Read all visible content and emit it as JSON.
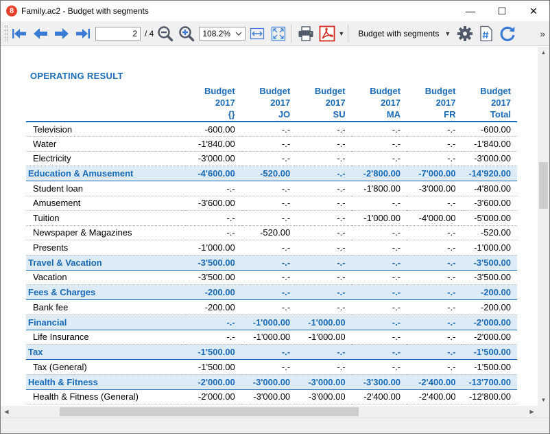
{
  "window": {
    "title": "Family.ac2 - Budget with segments",
    "app_icon": "8",
    "minimize": "—",
    "maximize": "☐",
    "close": "✕"
  },
  "toolbar": {
    "page_current": "2",
    "page_total": "/ 4",
    "zoom": "108.2%",
    "layout": "Budget with segments",
    "more": "»"
  },
  "report": {
    "section_title": "OPERATING RESULT",
    "columns": [
      {
        "l1": "",
        "l2": "",
        "l3": ""
      },
      {
        "l1": "Budget",
        "l2": "2017",
        "l3": "{}"
      },
      {
        "l1": "Budget",
        "l2": "2017",
        "l3": "JO"
      },
      {
        "l1": "Budget",
        "l2": "2017",
        "l3": "SU"
      },
      {
        "l1": "Budget",
        "l2": "2017",
        "l3": "MA"
      },
      {
        "l1": "Budget",
        "l2": "2017",
        "l3": "FR"
      },
      {
        "l1": "Budget",
        "l2": "2017",
        "l3": "Total"
      }
    ],
    "rows": [
      {
        "type": "item",
        "cells": [
          "Television",
          "-600.00",
          "-.-",
          "-.-",
          "-.-",
          "-.-",
          "-600.00"
        ]
      },
      {
        "type": "item",
        "cells": [
          "Water",
          "-1'840.00",
          "-.-",
          "-.-",
          "-.-",
          "-.-",
          "-1'840.00"
        ]
      },
      {
        "type": "item",
        "cells": [
          "Electricity",
          "-3'000.00",
          "-.-",
          "-.-",
          "-.-",
          "-.-",
          "-3'000.00"
        ]
      },
      {
        "type": "group",
        "cells": [
          "Education & Amusement",
          "-4'600.00",
          "-520.00",
          "-.-",
          "-2'800.00",
          "-7'000.00",
          "-14'920.00"
        ]
      },
      {
        "type": "item",
        "cells": [
          "Student loan",
          "-.-",
          "-.-",
          "-.-",
          "-1'800.00",
          "-3'000.00",
          "-4'800.00"
        ]
      },
      {
        "type": "item",
        "cells": [
          "Amusement",
          "-3'600.00",
          "-.-",
          "-.-",
          "-.-",
          "-.-",
          "-3'600.00"
        ]
      },
      {
        "type": "item",
        "cells": [
          "Tuition",
          "-.-",
          "-.-",
          "-.-",
          "-1'000.00",
          "-4'000.00",
          "-5'000.00"
        ]
      },
      {
        "type": "item",
        "cells": [
          "Newspaper & Magazines",
          "-.-",
          "-520.00",
          "-.-",
          "-.-",
          "-.-",
          "-520.00"
        ]
      },
      {
        "type": "item",
        "cells": [
          "Presents",
          "-1'000.00",
          "-.-",
          "-.-",
          "-.-",
          "-.-",
          "-1'000.00"
        ]
      },
      {
        "type": "group",
        "cells": [
          "Travel & Vacation",
          "-3'500.00",
          "-.-",
          "-.-",
          "-.-",
          "-.-",
          "-3'500.00"
        ]
      },
      {
        "type": "item",
        "cells": [
          "Vacation",
          "-3'500.00",
          "-.-",
          "-.-",
          "-.-",
          "-.-",
          "-3'500.00"
        ]
      },
      {
        "type": "group",
        "cells": [
          "Fees & Charges",
          "-200.00",
          "-.-",
          "-.-",
          "-.-",
          "-.-",
          "-200.00"
        ]
      },
      {
        "type": "item",
        "cells": [
          "Bank fee",
          "-200.00",
          "-.-",
          "-.-",
          "-.-",
          "-.-",
          "-200.00"
        ]
      },
      {
        "type": "group",
        "cells": [
          "Financial",
          "-.-",
          "-1'000.00",
          "-1'000.00",
          "-.-",
          "-.-",
          "-2'000.00"
        ]
      },
      {
        "type": "item",
        "cells": [
          "Life Insurance",
          "-.-",
          "-1'000.00",
          "-1'000.00",
          "-.-",
          "-.-",
          "-2'000.00"
        ]
      },
      {
        "type": "group",
        "cells": [
          "Tax",
          "-1'500.00",
          "-.-",
          "-.-",
          "-.-",
          "-.-",
          "-1'500.00"
        ]
      },
      {
        "type": "item",
        "cells": [
          "Tax (General)",
          "-1'500.00",
          "-.-",
          "-.-",
          "-.-",
          "-.-",
          "-1'500.00"
        ]
      },
      {
        "type": "group",
        "cells": [
          "Health & Fitness",
          "-2'000.00",
          "-3'000.00",
          "-3'000.00",
          "-3'300.00",
          "-2'400.00",
          "-13'700.00"
        ]
      },
      {
        "type": "item",
        "cells": [
          "Health & Fitness (General)",
          "-2'000.00",
          "-3'000.00",
          "-3'000.00",
          "-2'400.00",
          "-2'400.00",
          "-12'800.00"
        ]
      }
    ]
  },
  "colors": {
    "accent": "#1a6ab5",
    "group_background": "#dcebf5",
    "pdf_red": "#d3291e"
  },
  "icons": {
    "first_page": "arrow-first-icon",
    "prev_page": "arrow-left-icon",
    "next_page": "arrow-right-icon",
    "last_page": "arrow-last-icon",
    "zoom_out": "zoom-out-icon",
    "zoom_in": "zoom-in-icon",
    "fit_width": "fit-width-icon",
    "fit_page": "fit-page-icon",
    "print": "printer-icon",
    "pdf": "pdf-icon",
    "settings": "gear-icon",
    "page_number": "page-number-icon",
    "refresh": "refresh-icon"
  }
}
